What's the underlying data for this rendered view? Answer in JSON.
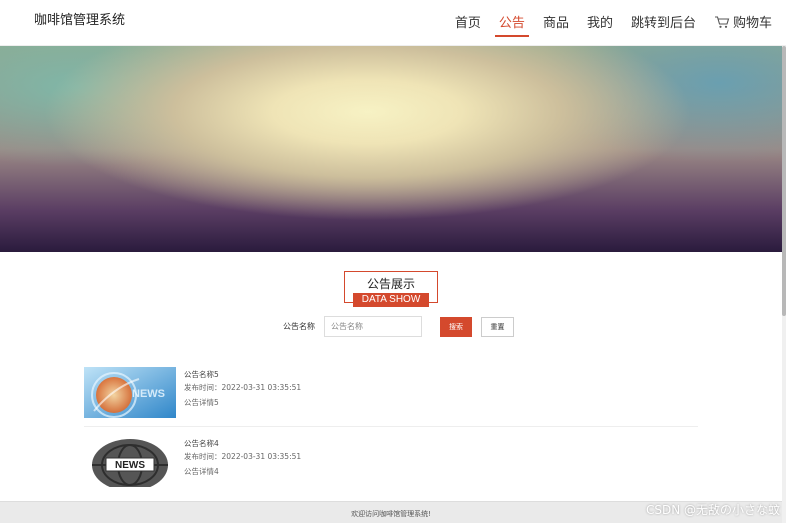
{
  "header": {
    "brand": "咖啡馆管理系统",
    "nav": [
      "首页",
      "公告",
      "商品",
      "我的",
      "跳转到后台",
      "购物车"
    ],
    "active_index": 1
  },
  "banner": {
    "dots": 3,
    "active_dot": 0
  },
  "section": {
    "title_cn": "公告展示",
    "title_en": "DATA SHOW"
  },
  "search": {
    "label": "公告名称",
    "placeholder": "公告名称",
    "search_label": "搜索",
    "reset_label": "重置"
  },
  "items": [
    {
      "name": "公告名称5",
      "time": "发布时间：2022-03-31 03:35:51",
      "detail": "公告详情5",
      "thumb_text": "NEWS"
    },
    {
      "name": "公告名称4",
      "time": "发布时间：2022-03-31 03:35:51",
      "detail": "公告详情4",
      "thumb_text": "NEWS"
    }
  ],
  "footer": {
    "text": "欢迎访问咖啡馆管理系统!"
  },
  "watermark": "CSDN @无敌の小さな蚊",
  "colors": {
    "accent": "#d4492d",
    "active_dot": "#e8793f"
  }
}
